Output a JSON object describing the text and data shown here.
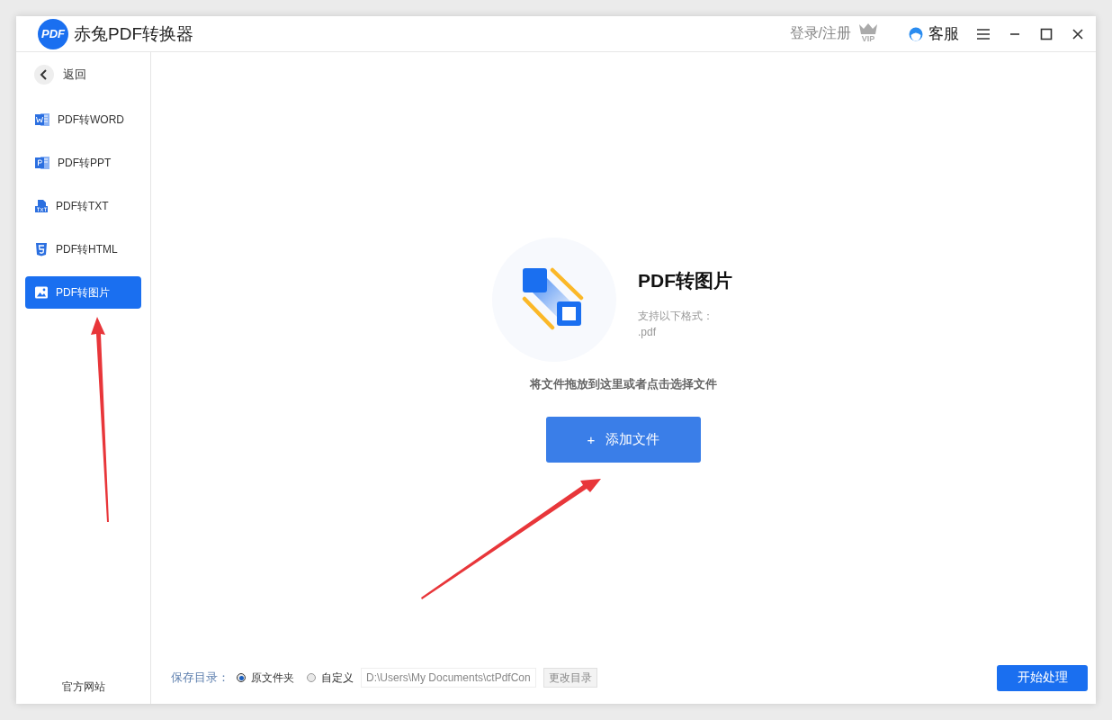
{
  "title_bar": {
    "logo": "PDF",
    "title": "赤兔PDF转换器",
    "login": "登录/注册",
    "vip_badge": "VIP",
    "service": "客服"
  },
  "sidebar": {
    "back": "返回",
    "items": [
      {
        "kind": "word",
        "label": "PDF转WORD",
        "selected": false
      },
      {
        "kind": "ppt",
        "label": "PDF转PPT",
        "selected": false
      },
      {
        "kind": "txt",
        "label": "PDF转TXT",
        "selected": false
      },
      {
        "kind": "html",
        "label": "PDF转HTML",
        "selected": false
      },
      {
        "kind": "image",
        "label": "PDF转图片",
        "selected": true
      }
    ],
    "footer_link": "官方网站"
  },
  "drop_zone": {
    "title": "PDF转图片",
    "formats_label": "支持以下格式：",
    "formats": ".pdf",
    "hint": "将文件拖放到这里或者点击选择文件",
    "add_button": {
      "icon": "+",
      "label": "添加文件"
    }
  },
  "save_bar": {
    "label": "保存目录：",
    "options": [
      {
        "label": "原文件夹",
        "selected": true
      },
      {
        "label": "自定义",
        "selected": false
      }
    ],
    "path": "D:\\Users\\My Documents\\ctPdfCon",
    "change_button": "更改目录",
    "start_button": "开始处理"
  }
}
